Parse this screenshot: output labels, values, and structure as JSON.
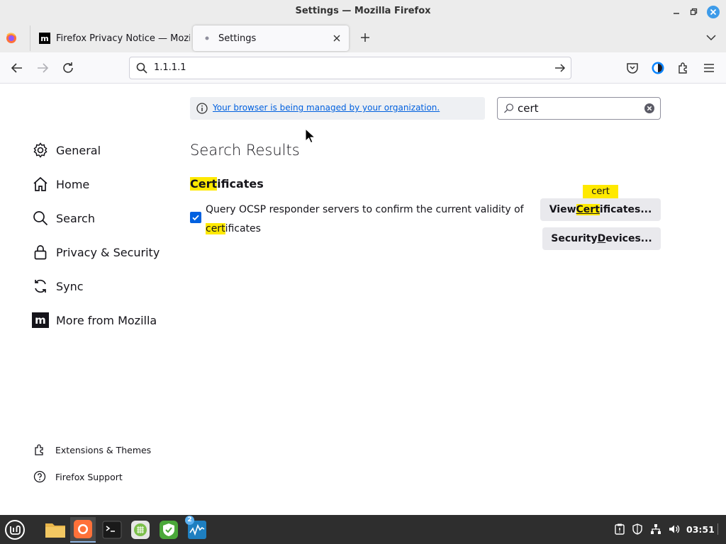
{
  "window": {
    "title": "Settings — Mozilla Firefox"
  },
  "tabs": [
    {
      "label": "Firefox Privacy Notice — Mozilla",
      "active": false,
      "icon": "mozilla-m-icon"
    },
    {
      "label": "Settings",
      "active": true,
      "icon": "dot-icon"
    }
  ],
  "navbar": {
    "url": "1.1.1.1"
  },
  "banner": {
    "text": "Your browser is being managed by your organization."
  },
  "search": {
    "value": "cert"
  },
  "sidebar": {
    "items": [
      {
        "label": "General",
        "icon": "gear-icon"
      },
      {
        "label": "Home",
        "icon": "home-icon"
      },
      {
        "label": "Search",
        "icon": "search-icon"
      },
      {
        "label": "Privacy & Security",
        "icon": "lock-icon"
      },
      {
        "label": "Sync",
        "icon": "sync-icon"
      },
      {
        "label": "More from Mozilla",
        "icon": "mozilla-icon"
      }
    ],
    "footer": [
      {
        "label": "Extensions & Themes",
        "icon": "puzzle-icon"
      },
      {
        "label": "Firefox Support",
        "icon": "help-icon"
      }
    ]
  },
  "main": {
    "results_title": "Search Results",
    "section_title_highlight": "Cert",
    "section_title_rest": "ificates",
    "ocsp_text_before": "Query OCSP responder servers to confirm the current validity of ",
    "ocsp_highlight": "cert",
    "ocsp_text_after": "ificates",
    "ocsp_checked": true,
    "view_certs_pre": "View ",
    "view_certs_highlight": "Cert",
    "view_certs_post": "ificates...",
    "security_devices_pre": "Security ",
    "security_devices_accesskey": "D",
    "security_devices_post": "evices...",
    "tooltip": "cert"
  },
  "taskbar": {
    "clock": "03:51",
    "badge": "2"
  },
  "colors": {
    "highlight": "#ffe900",
    "accent": "#0061e0",
    "link": "#0060df"
  }
}
